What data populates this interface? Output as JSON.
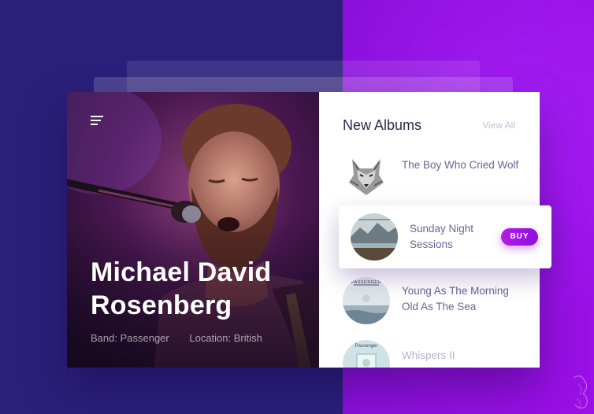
{
  "artist": {
    "name": "Michael David Rosenberg",
    "band": "Band: Passenger",
    "location": "Location: British"
  },
  "albums_panel": {
    "title": "New Albums",
    "view_all": "View All",
    "albums": [
      {
        "title": "The Boy Who Cried Wolf"
      },
      {
        "title": "Sunday Night Sessions",
        "action": "BUY"
      },
      {
        "title": "Young As The Morning Old As The Sea",
        "cover_text": "PASSENGER"
      },
      {
        "title": "Whispers II",
        "cover_text": "Passenger"
      }
    ]
  },
  "colors": {
    "bg_left": "#2b1f7a",
    "bg_right": "#8a10d9",
    "accent": "#9a12e3",
    "album_title": "#6b6495"
  },
  "icons": {
    "menu": "hamburger-menu-icon"
  }
}
